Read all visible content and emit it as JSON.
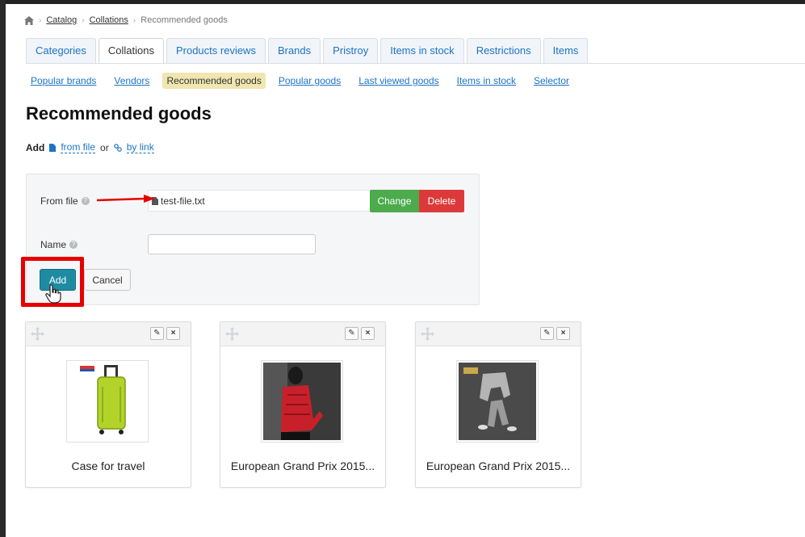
{
  "breadcrumb": {
    "items": [
      "Catalog",
      "Collations"
    ],
    "current": "Recommended goods"
  },
  "tabs": [
    "Categories",
    "Collations",
    "Products reviews",
    "Brands",
    "Pristroy",
    "Items in stock",
    "Restrictions",
    "Items"
  ],
  "subnav": {
    "items": [
      "Popular brands",
      "Vendors"
    ],
    "current": "Recommended goods",
    "after": [
      "Popular goods",
      "Last viewed goods",
      "Items in stock",
      "Selector"
    ]
  },
  "page_title": "Recommended goods",
  "add_line": {
    "label": "Add",
    "from_file": "from file",
    "or": "or",
    "by_link": "by link"
  },
  "form": {
    "from_file_label": "From file",
    "file_name": "test-file.txt",
    "change": "Change",
    "delete": "Delete",
    "name_label": "Name",
    "name_value": "",
    "add": "Add",
    "cancel": "Cancel"
  },
  "cards": [
    {
      "title": "Case for travel",
      "icon": "suitcase"
    },
    {
      "title": "European Grand Prix 2015...",
      "icon": "red-jacket"
    },
    {
      "title": "European Grand Prix 2015...",
      "icon": "gray-outfit"
    }
  ],
  "colors": {
    "accent_link": "#1b74c5",
    "change": "#4cab4c",
    "delete": "#dc3a3a",
    "add": "#1f8ba3",
    "highlight": "#e60000"
  }
}
